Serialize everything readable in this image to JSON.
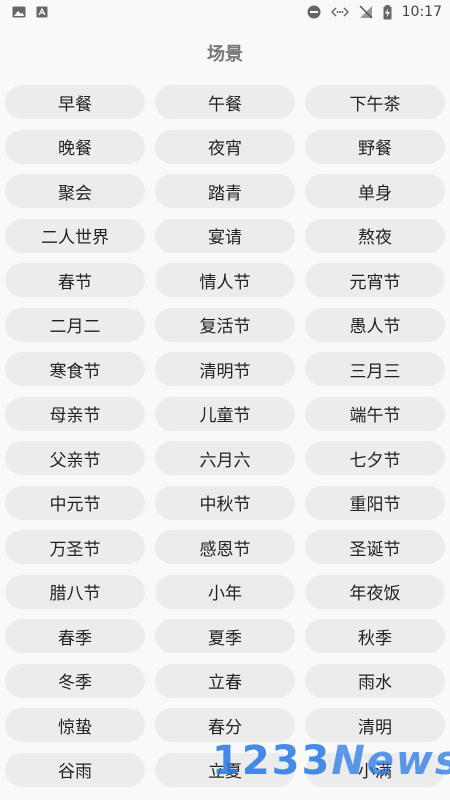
{
  "status_bar": {
    "time": "10:17"
  },
  "page": {
    "title": "场景"
  },
  "scenes": [
    "早餐",
    "午餐",
    "下午茶",
    "晚餐",
    "夜宵",
    "野餐",
    "聚会",
    "踏青",
    "单身",
    "二人世界",
    "宴请",
    "熬夜",
    "春节",
    "情人节",
    "元宵节",
    "二月二",
    "复活节",
    "愚人节",
    "寒食节",
    "清明节",
    "三月三",
    "母亲节",
    "儿童节",
    "端午节",
    "父亲节",
    "六月六",
    "七夕节",
    "中元节",
    "中秋节",
    "重阳节",
    "万圣节",
    "感恩节",
    "圣诞节",
    "腊八节",
    "小年",
    "年夜饭",
    "春季",
    "夏季",
    "秋季",
    "冬季",
    "立春",
    "雨水",
    "惊蛰",
    "春分",
    "清明",
    "谷雨",
    "立夏",
    "小满"
  ],
  "watermark": {
    "digits": "1233",
    "word": "News"
  }
}
